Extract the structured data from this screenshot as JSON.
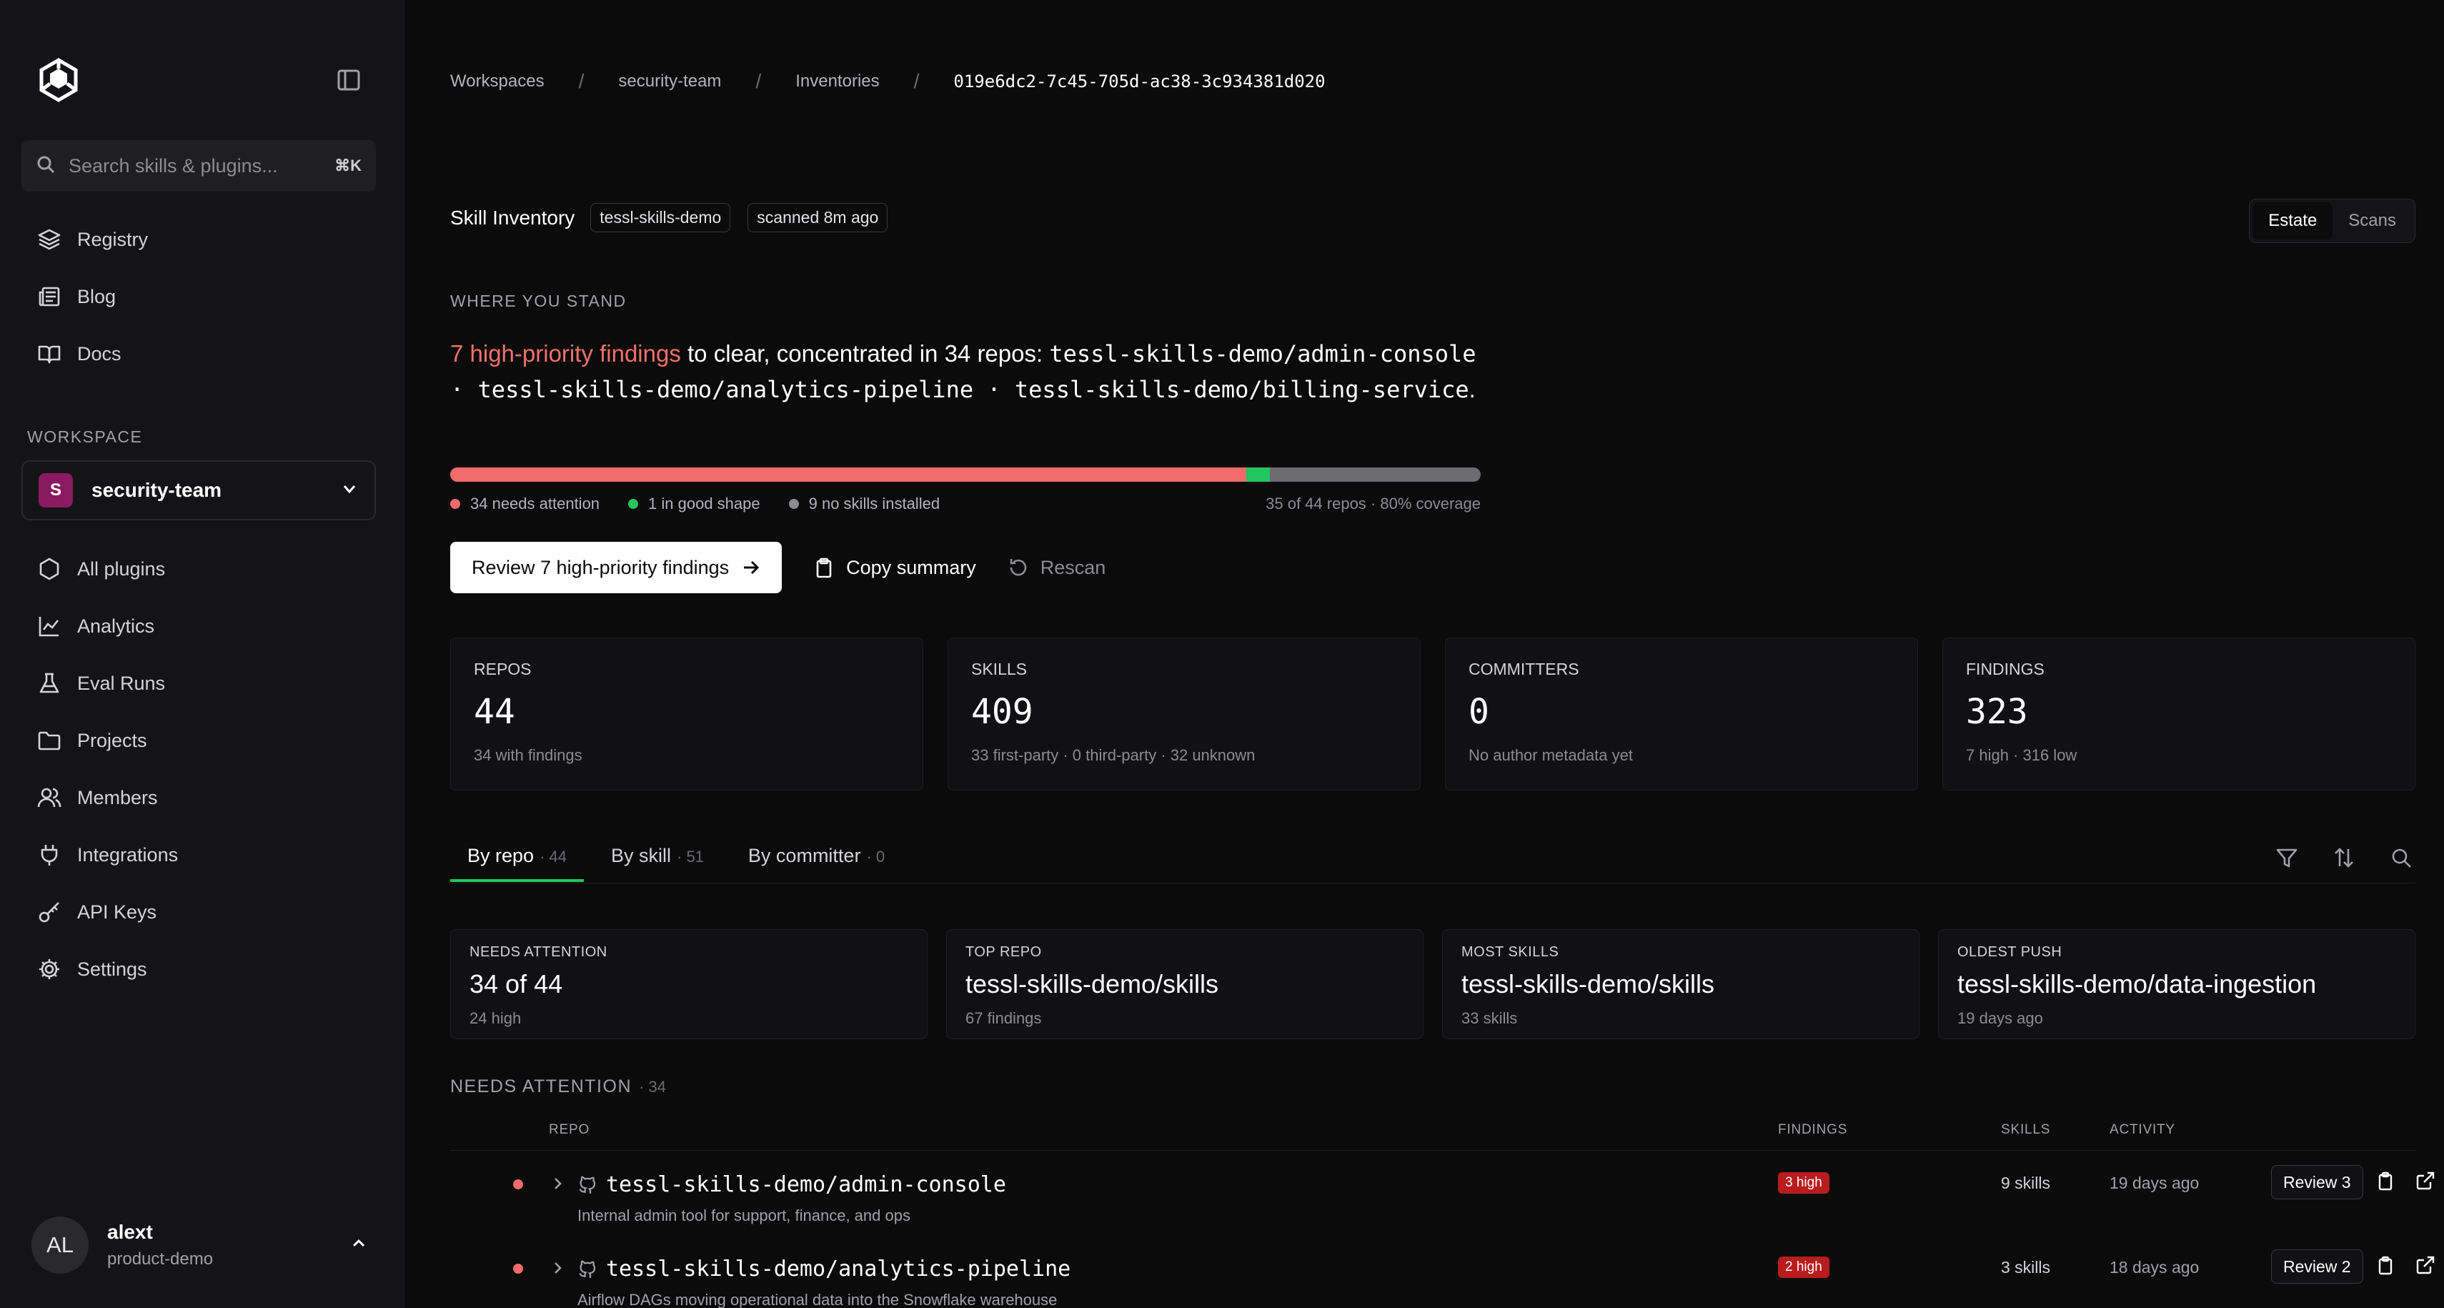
{
  "sidebar": {
    "search_placeholder": "Search skills & plugins...",
    "search_shortcut": "⌘K",
    "top_nav": [
      {
        "label": "Registry",
        "icon": "layers-icon"
      },
      {
        "label": "Blog",
        "icon": "newspaper-icon"
      },
      {
        "label": "Docs",
        "icon": "book-icon"
      }
    ],
    "workspace_label": "WORKSPACE",
    "workspace": {
      "initial": "S",
      "name": "security-team",
      "color": "#8b1a62"
    },
    "workspace_nav": [
      {
        "label": "All plugins",
        "icon": "hexagon-icon"
      },
      {
        "label": "Analytics",
        "icon": "chart-line-icon"
      },
      {
        "label": "Eval Runs",
        "icon": "flask-icon"
      },
      {
        "label": "Projects",
        "icon": "folder-icon"
      },
      {
        "label": "Members",
        "icon": "users-icon"
      },
      {
        "label": "Integrations",
        "icon": "plug-icon"
      },
      {
        "label": "API Keys",
        "icon": "key-icon"
      },
      {
        "label": "Settings",
        "icon": "gear-icon"
      }
    ],
    "user": {
      "initials": "AL",
      "name": "alext",
      "org": "product-demo"
    }
  },
  "breadcrumb": [
    "Workspaces",
    "security-team",
    "Inventories",
    "019e6dc2-7c45-705d-ac38-3c934381d020"
  ],
  "inventory": {
    "title": "Skill Inventory",
    "chip_project": "tessl-skills-demo",
    "chip_scanned": "scanned 8m ago",
    "view_tabs": [
      "Estate",
      "Scans"
    ],
    "view_active": "Estate"
  },
  "summary": {
    "label": "WHERE YOU STAND",
    "highlight": "7 high-priority findings",
    "text_mid": " to clear, concentrated in 34 repos: ",
    "repos_text": "tessl-skills-demo/admin-console · tessl-skills-demo/analytics-pipeline · tessl-skills-demo/billing-service",
    "text_end": ".",
    "progress": {
      "needs_attention": 34,
      "good_shape": 1,
      "no_skills": 9,
      "total": 44
    },
    "legend": {
      "attention": "34 needs attention",
      "good": "1 in good shape",
      "none": "9 no skills installed",
      "coverage": "35 of 44 repos · 80% coverage"
    },
    "colors": {
      "attention": "#f26b6b",
      "good": "#22c55e",
      "none": "#6b6b70"
    },
    "actions": {
      "primary": "Review 7 high-priority findings",
      "copy": "Copy summary",
      "rescan": "Rescan"
    }
  },
  "stats": [
    {
      "label": "REPOS",
      "value": "44",
      "sub": "34 with findings"
    },
    {
      "label": "SKILLS",
      "value": "409",
      "sub": "33 first-party · 0 third-party · 32 unknown"
    },
    {
      "label": "COMMITTERS",
      "value": "0",
      "sub": "No author metadata yet"
    },
    {
      "label": "FINDINGS",
      "value": "323",
      "sub": "7 high · 316 low"
    }
  ],
  "tabs": [
    {
      "label": "By repo",
      "count": "· 44"
    },
    {
      "label": "By skill",
      "count": "· 51"
    },
    {
      "label": "By committer",
      "count": "· 0"
    }
  ],
  "highlights": [
    {
      "label": "NEEDS ATTENTION",
      "value": "34 of 44",
      "sub": "24 high"
    },
    {
      "label": "TOP REPO",
      "value": "tessl-skills-demo/skills",
      "sub": "67 findings"
    },
    {
      "label": "MOST SKILLS",
      "value": "tessl-skills-demo/skills",
      "sub": "33 skills"
    },
    {
      "label": "OLDEST PUSH",
      "value": "tessl-skills-demo/data-ingestion",
      "sub": "19 days ago"
    }
  ],
  "needs_attention": {
    "label": "NEEDS ATTENTION",
    "count": "· 34",
    "columns": {
      "repo": "REPO",
      "findings": "FINDINGS",
      "skills": "SKILLS",
      "activity": "ACTIVITY"
    },
    "rows": [
      {
        "name": "tessl-skills-demo/admin-console",
        "desc": "Internal admin tool for support, finance, and ops",
        "badge": "3 high",
        "skills": "9 skills",
        "activity": "19 days ago",
        "review": "Review 3"
      },
      {
        "name": "tessl-skills-demo/analytics-pipeline",
        "desc": "Airflow DAGs moving operational data into the Snowflake warehouse",
        "badge": "2 high",
        "skills": "3 skills",
        "activity": "18 days ago",
        "review": "Review 2"
      }
    ]
  }
}
